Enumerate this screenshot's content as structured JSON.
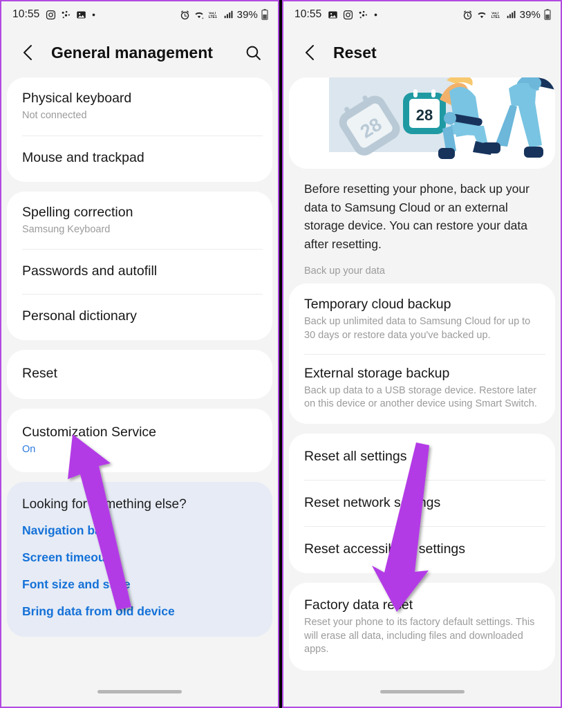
{
  "theme": {
    "accent_purple": "#b14ae0",
    "arrow_color": "#b33ae6",
    "link_blue": "#1471d8",
    "value_blue": "#2c7ae0",
    "card_white": "#ffffff",
    "page_bg": "#f4f4f4",
    "suggest_bg": "#e6ebf5",
    "subtext_gray": "#9b9b9b"
  },
  "left_panel": {
    "status_bar": {
      "time": "10:55",
      "left_icons": [
        "instagram-icon",
        "dots-icon",
        "gallery-icon",
        "dot-icon"
      ],
      "right_icons": [
        "alarm-icon",
        "wifi-icon",
        "volte-icon",
        "signal-icon"
      ],
      "battery_percent": "39%",
      "battery_icon": "battery-icon"
    },
    "app_bar": {
      "back_icon": "back-chevron-icon",
      "title": "General management",
      "search_icon": "search-icon"
    },
    "groups": [
      {
        "rows": [
          {
            "title": "Physical keyboard",
            "sub": "Not connected",
            "sub_accent": false
          },
          {
            "title": "Mouse and trackpad",
            "sub": "",
            "sub_accent": false
          }
        ]
      },
      {
        "rows": [
          {
            "title": "Spelling correction",
            "sub": "Samsung Keyboard",
            "sub_accent": false
          },
          {
            "title": "Passwords and autofill",
            "sub": "",
            "sub_accent": false
          },
          {
            "title": "Personal dictionary",
            "sub": "",
            "sub_accent": false
          }
        ]
      },
      {
        "rows": [
          {
            "title": "Reset",
            "sub": "",
            "sub_accent": false
          }
        ]
      },
      {
        "rows": [
          {
            "title": "Customization Service",
            "sub": "On",
            "sub_accent": true
          }
        ]
      }
    ],
    "suggestions": {
      "heading": "Looking for something else?",
      "links": [
        "Navigation bar",
        "Screen timeout",
        "Font size and style",
        "Bring data from old device"
      ]
    },
    "nav_handle": "home-handle"
  },
  "right_panel": {
    "status_bar": {
      "time": "10:55",
      "left_icons": [
        "gallery-icon",
        "instagram-icon",
        "dots-icon",
        "dot-icon"
      ],
      "right_icons": [
        "alarm-icon",
        "wifi-icon",
        "volte-icon",
        "signal-icon"
      ],
      "battery_percent": "39%",
      "battery_icon": "battery-icon"
    },
    "app_bar": {
      "back_icon": "back-chevron-icon",
      "title": "Reset"
    },
    "hero": {
      "illustration_name": "reset-backup-illustration",
      "calendar_day": "28",
      "calendar_shadow_day": "28"
    },
    "intro_text": "Before resetting your phone, back up your data to Samsung Cloud or an external storage device. You can restore your data after resetting.",
    "section_label": "Back up your data",
    "groups": [
      {
        "rows": [
          {
            "title": "Temporary cloud backup",
            "sub": "Back up unlimited data to Samsung Cloud for up to 30 days or restore data you've backed up."
          },
          {
            "title": "External storage backup",
            "sub": "Back up data to a USB storage device. Restore later on this device or another device using Smart Switch."
          }
        ]
      },
      {
        "rows": [
          {
            "title": "Reset all settings",
            "sub": ""
          },
          {
            "title": "Reset network settings",
            "sub": ""
          },
          {
            "title": "Reset accessibility settings",
            "sub": ""
          }
        ]
      },
      {
        "rows": [
          {
            "title": "Factory data reset",
            "sub": "Reset your phone to its factory default settings. This will erase all data, including files and downloaded apps."
          }
        ]
      }
    ],
    "nav_handle": "home-handle"
  },
  "annotations": [
    {
      "name": "arrow-pointing-to-reset",
      "target": "Reset"
    },
    {
      "name": "arrow-pointing-to-factory-data-reset",
      "target": "Factory data reset"
    }
  ]
}
